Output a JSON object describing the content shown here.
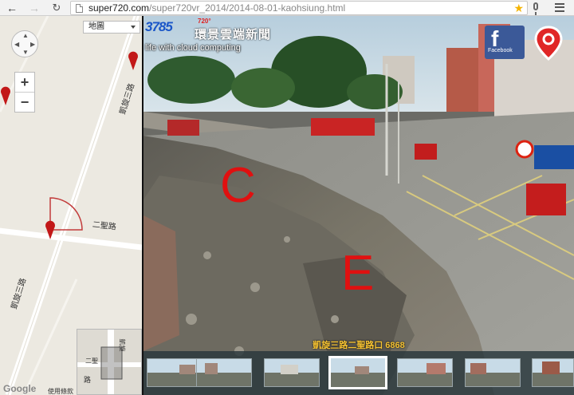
{
  "browser": {
    "url_host": "super720.com",
    "url_path": "/super720vr_2014/2014-08-01-kaohsiung.html",
    "icons": [
      "back-icon",
      "forward-icon",
      "reload-icon",
      "page-icon",
      "star-icon",
      "mic-icon",
      "menu-icon"
    ]
  },
  "map": {
    "type_select": "地圖",
    "zoom_in": "+",
    "zoom_out": "−",
    "labels": {
      "road_1": "凱旋三路",
      "road_2": "二聖路",
      "road_3": "凱旋三路"
    },
    "minimap_labels": {
      "road_a": "凱旋",
      "road_b": "二聖",
      "road_c": "路"
    },
    "attribution": "Google",
    "terms": "使用條款"
  },
  "pano": {
    "logo_num_blue": "3785",
    "logo_num_red": "",
    "logo_720": "720°",
    "logo_name": "環景雲端新聞",
    "logo_tag": "life with cloud computing",
    "facebook_label": "Facebook",
    "letter_c": "C",
    "letter_e": "E",
    "caption": "凱旋三路二聖路口 6868",
    "thumbnail_count": 7,
    "active_thumbnail": 4
  },
  "colors": {
    "accent_red": "#e01010",
    "facebook_blue": "#3b5998",
    "caption_gold": "#f5c232"
  }
}
